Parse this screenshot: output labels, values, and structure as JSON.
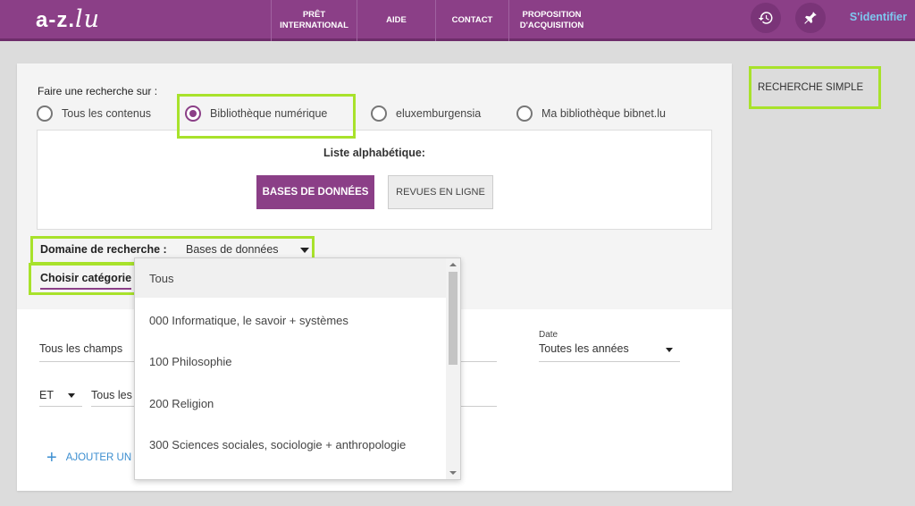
{
  "header": {
    "logo_text": "a-z.",
    "logo_lu": "lu",
    "nav": [
      {
        "label": "PRÊT\nINTERNATIONAL"
      },
      {
        "label": "AIDE"
      },
      {
        "label": "CONTACT"
      },
      {
        "label": "PROPOSITION\nD'ACQUISITION"
      }
    ],
    "signin": "S'identifier"
  },
  "search": {
    "prompt": "Faire une recherche sur :",
    "options": [
      {
        "label": "Tous les contenus",
        "checked": false
      },
      {
        "label": "Bibliothèque numérique",
        "checked": true
      },
      {
        "label": "eluxemburgensia",
        "checked": false
      },
      {
        "label": "Ma bibliothèque bibnet.lu",
        "checked": false
      }
    ],
    "alpha_title": "Liste alphabétique:",
    "btn_bases": "BASES DE DONNÉES",
    "btn_revues": "REVUES EN LIGNE",
    "domaine_label": "Domaine de recherche :",
    "domaine_value": "Bases de données",
    "categorie": "Choisir catégorie",
    "field1": "Tous les champs",
    "field2_op": "ET",
    "field2": "Tous les",
    "date_label": "Date",
    "date_value": "Toutes les années",
    "add_label": "AJOUTER UN"
  },
  "dropdown": {
    "items": [
      "Tous",
      "000 Informatique, le savoir + systèmes",
      "100 Philosophie",
      "200 Religion",
      "300 Sciences sociales, sociologie + anthropologie"
    ]
  },
  "side": {
    "simple": "RECHERCHE SIMPLE"
  },
  "colors": {
    "brand": "#8b3f87",
    "highlight": "#a8e22b",
    "link": "#3b8ed0"
  }
}
